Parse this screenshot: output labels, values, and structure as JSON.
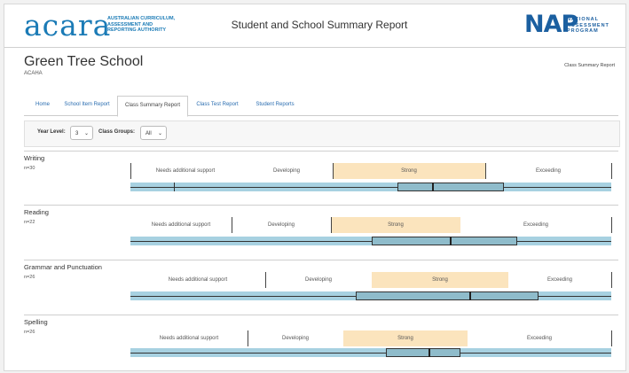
{
  "header": {
    "acara_wordmark": "acara",
    "acara_tagline": [
      "AUSTRALIAN CURRICULUM,",
      "ASSESSMENT AND",
      "REPORTING AUTHORITY"
    ],
    "title": "Student and School Summary Report",
    "nap_wordmark": "NAP",
    "nap_tagline": [
      "NATIONAL",
      "ASSESSMENT",
      "PROGRAM"
    ],
    "brand_color": "#1b7bb6"
  },
  "school": {
    "name": "Green Tree School",
    "code": "ACAHA",
    "report_type": "Class Summary Report"
  },
  "tabs": [
    {
      "label": "Home",
      "active": false
    },
    {
      "label": "School Item Report",
      "active": false
    },
    {
      "label": "Class Summary Report",
      "active": true
    },
    {
      "label": "Class Test Report",
      "active": false
    },
    {
      "label": "Student Reports",
      "active": false
    }
  ],
  "filters": {
    "year_level_label": "Year Level:",
    "year_level_value": "3",
    "class_groups_label": "Class Groups:",
    "class_groups_value": "All"
  },
  "domains": [
    {
      "name": "Writing",
      "n": "n=30",
      "bands": [
        "Needs additional support",
        "Developing",
        "Strong",
        "Exceeding"
      ],
      "highlight_band": "Strong",
      "distribution": {
        "min": 0.09,
        "q1": 0.556,
        "median": 0.626,
        "q3": 0.77
      }
    },
    {
      "name": "Reading",
      "n": "n=22",
      "bands": [
        "Needs additional support",
        "Developing",
        "Strong",
        "Exceeding"
      ],
      "highlight_band": "Strong",
      "distribution": {
        "min": null,
        "q1": 0.502,
        "median": 0.664,
        "q3": 0.79
      }
    },
    {
      "name": "Grammar and Punctuation",
      "n": "n=26",
      "bands": [
        "Needs additional support",
        "Developing",
        "Strong",
        "Exceeding"
      ],
      "highlight_band": "Strong",
      "distribution": {
        "min": null,
        "q1": 0.469,
        "median": 0.705,
        "q3": 0.842
      }
    },
    {
      "name": "Spelling",
      "n": "n=26",
      "bands": [
        "Needs additional support",
        "Developing",
        "Strong",
        "Exceeding"
      ],
      "highlight_band": "Strong",
      "distribution": {
        "min": null,
        "q1": 0.53,
        "median": 0.627,
        "q3": 0.684
      }
    }
  ]
}
